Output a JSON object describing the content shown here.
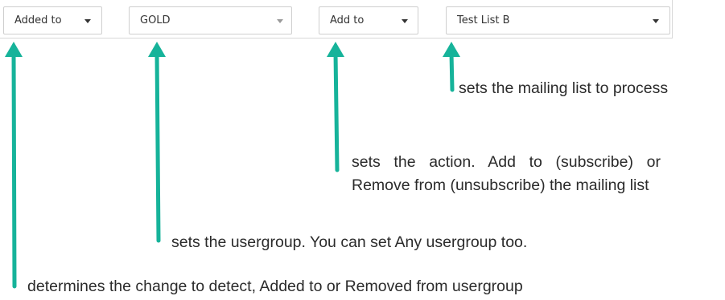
{
  "toolbar": {
    "trigger_select": {
      "value": "Added to"
    },
    "usergroup_select": {
      "value": "GOLD"
    },
    "action_select": {
      "value": "Add to"
    },
    "mailing_list_select": {
      "value": "Test List B"
    }
  },
  "annotations": {
    "mailing_list": "sets the mailing list to process",
    "action_line1": "sets the action. Add to (subscribe)",
    "action_line2": "or Remove from (unsubscribe) the",
    "action_line3": "mailing list",
    "usergroup": "sets the usergroup. You can set Any usergroup too.",
    "trigger": "determines the change to detect, Added to or Removed from usergroup"
  },
  "colors": {
    "arrow": "#16b39a",
    "text": "#2b2b2b",
    "border": "#cfcfcf"
  }
}
